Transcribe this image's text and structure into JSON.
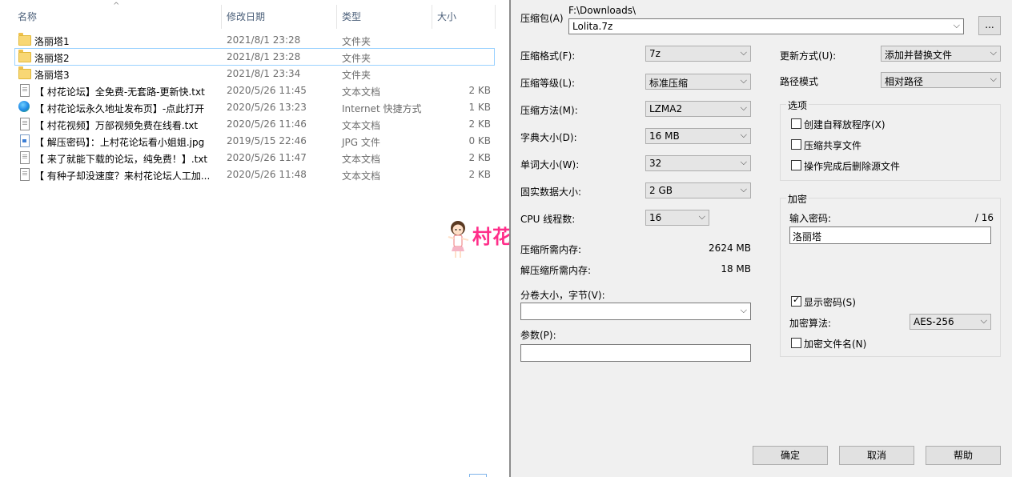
{
  "explorer": {
    "columns": {
      "name": "名称",
      "date": "修改日期",
      "type": "类型",
      "size": "大小"
    },
    "files": [
      {
        "icon": "folder-icon",
        "name": "洛丽塔1",
        "date": "2021/8/1 23:28",
        "type": "文件夹",
        "size": ""
      },
      {
        "icon": "folder-icon",
        "name": "洛丽塔2",
        "date": "2021/8/1 23:28",
        "type": "文件夹",
        "size": "",
        "selected": true
      },
      {
        "icon": "folder-icon",
        "name": "洛丽塔3",
        "date": "2021/8/1 23:34",
        "type": "文件夹",
        "size": ""
      },
      {
        "icon": "text-file-icon",
        "name": "【 村花论坛】全免费-无套路-更新快.txt",
        "date": "2020/5/26 11:45",
        "type": "文本文档",
        "size": "2 KB"
      },
      {
        "icon": "web-shortcut-icon",
        "name": "【 村花论坛永久地址发布页】-点此打开",
        "date": "2020/5/26 13:23",
        "type": "Internet 快捷方式",
        "size": "1 KB"
      },
      {
        "icon": "text-file-icon",
        "name": "【 村花视频】万部视频免费在线看.txt",
        "date": "2020/5/26 11:46",
        "type": "文本文档",
        "size": "2 KB"
      },
      {
        "icon": "image-file-icon",
        "name": "【 解压密码】：上村花论坛看小姐姐.jpg",
        "date": "2019/5/15 22:46",
        "type": "JPG 文件",
        "size": "0 KB"
      },
      {
        "icon": "text-file-icon",
        "name": "【 来了就能下载的论坛，纯免费！】.txt",
        "date": "2020/5/26 11:47",
        "type": "文本文档",
        "size": "2 KB"
      },
      {
        "icon": "text-file-icon",
        "name": "【 有种子却没速度？来村花论坛人工加...",
        "date": "2020/5/26 11:48",
        "type": "文本文档",
        "size": "2 KB"
      }
    ]
  },
  "watermark": {
    "text": "村花论坛"
  },
  "dialog": {
    "archive_label": "压缩包(A)",
    "archive_path": "F:\\Downloads\\",
    "archive_name": "Lolita.7z",
    "browse_label": "...",
    "format": {
      "label": "压缩格式(F):",
      "value": "7z"
    },
    "level": {
      "label": "压缩等级(L):",
      "value": "标准压缩"
    },
    "method": {
      "label": "压缩方法(M):",
      "value": "LZMA2"
    },
    "dict": {
      "label": "字典大小(D):",
      "value": "16 MB"
    },
    "word": {
      "label": "单词大小(W):",
      "value": "32"
    },
    "solid": {
      "label": "固实数据大小:",
      "value": "2 GB"
    },
    "cpu": {
      "label": "CPU 线程数:",
      "value": "16",
      "total": "/ 16"
    },
    "mem_compress": {
      "label": "压缩所需内存:",
      "value": "2624 MB"
    },
    "mem_decompress": {
      "label": "解压缩所需内存:",
      "value": "18 MB"
    },
    "volume": {
      "label": "分卷大小，字节(V):",
      "value": ""
    },
    "params": {
      "label": "参数(P):",
      "value": ""
    },
    "update": {
      "label": "更新方式(U):",
      "value": "添加并替换文件"
    },
    "pathmode": {
      "label": "路径模式",
      "value": "相对路径"
    },
    "options": {
      "title": "选项",
      "sfx": {
        "label": "创建自释放程序(X)",
        "checked": false
      },
      "shared": {
        "label": "压缩共享文件",
        "checked": false
      },
      "delete": {
        "label": "操作完成后删除源文件",
        "checked": false
      }
    },
    "encryption": {
      "title": "加密",
      "password_label": "输入密码:",
      "password_value": "洛丽塔",
      "show_password": {
        "label": "显示密码(S)",
        "checked": true
      },
      "method_label": "加密算法:",
      "method_value": "AES-256",
      "encrypt_names": {
        "label": "加密文件名(N)",
        "checked": false
      }
    },
    "buttons": {
      "ok": "确定",
      "cancel": "取消",
      "help": "帮助"
    }
  }
}
